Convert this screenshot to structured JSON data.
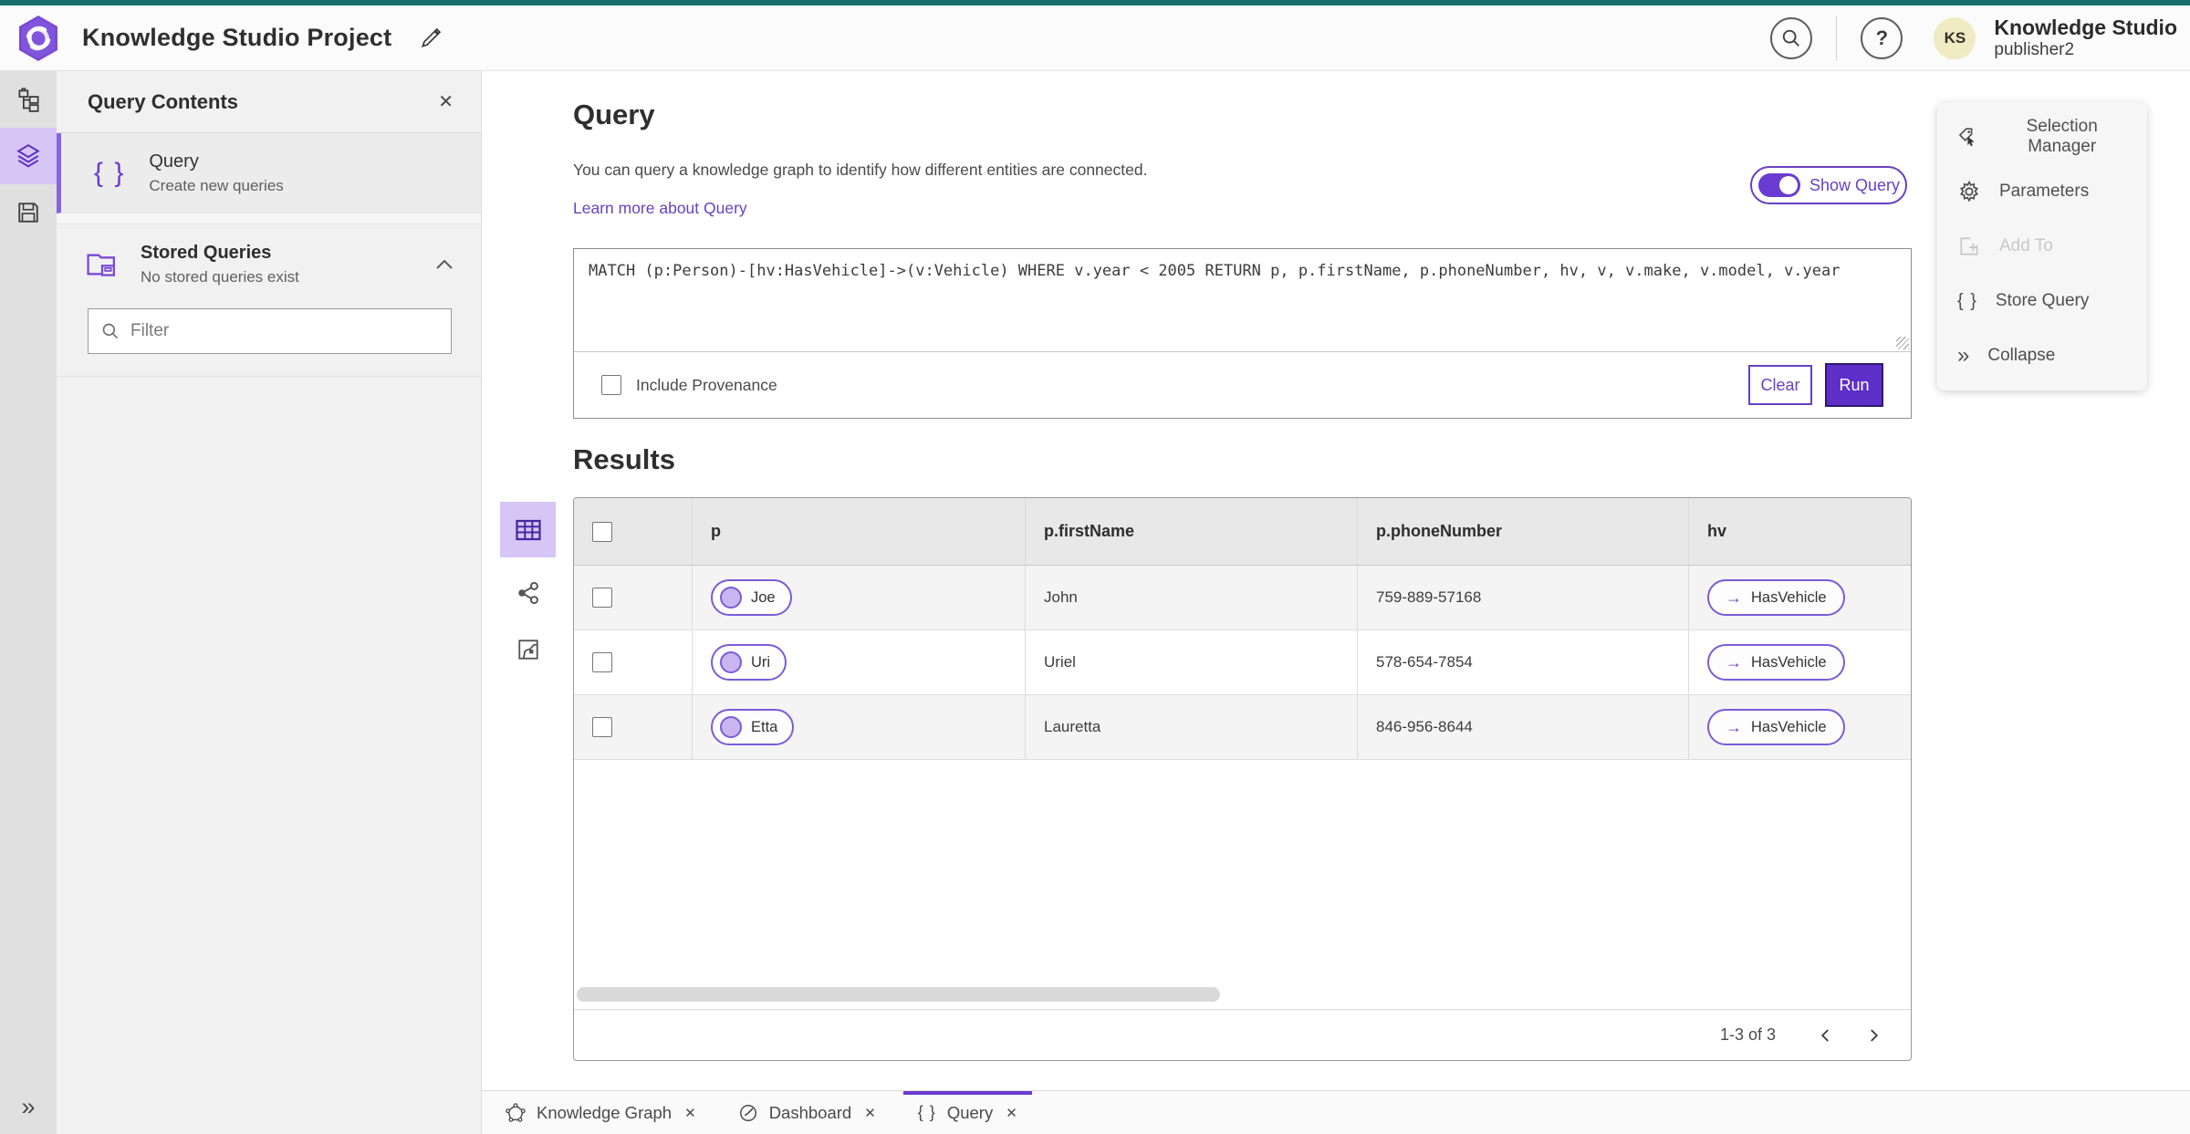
{
  "header": {
    "title": "Knowledge Studio Project",
    "user": {
      "initials": "KS",
      "name": "Knowledge Studio",
      "role": "publisher2"
    }
  },
  "left_panel": {
    "title": "Query Contents",
    "query_item": {
      "title": "Query",
      "subtitle": "Create new queries"
    },
    "stored_queries": {
      "title": "Stored Queries",
      "subtitle": "No stored queries exist"
    },
    "filter_placeholder": "Filter"
  },
  "query_section": {
    "title": "Query",
    "description": "You can query a knowledge graph to identify how different entities are connected.",
    "learn_more": "Learn more about Query",
    "show_query": "Show Query",
    "query_text": "MATCH (p:Person)-[hv:HasVehicle]->(v:Vehicle) WHERE v.year < 2005 RETURN p, p.firstName, p.phoneNumber, hv, v, v.make, v.model, v.year",
    "include_provenance": "Include Provenance",
    "clear": "Clear",
    "run": "Run"
  },
  "results": {
    "title": "Results",
    "columns": [
      "p",
      "p.firstName",
      "p.phoneNumber",
      "hv"
    ],
    "rows": [
      {
        "entity": "Joe",
        "firstName": "John",
        "phone": "759-889-57168",
        "relation": "HasVehicle"
      },
      {
        "entity": "Uri",
        "firstName": "Uriel",
        "phone": "578-654-7854",
        "relation": "HasVehicle"
      },
      {
        "entity": "Etta",
        "firstName": "Lauretta",
        "phone": "846-956-8644",
        "relation": "HasVehicle"
      }
    ],
    "pagination": "1-3 of 3"
  },
  "context_menu": {
    "items": [
      {
        "label": "Selection Manager",
        "disabled": false
      },
      {
        "label": "Parameters",
        "disabled": false
      },
      {
        "label": "Add To",
        "disabled": true
      },
      {
        "label": "Store Query",
        "disabled": false
      },
      {
        "label": "Collapse",
        "disabled": false
      }
    ]
  },
  "tabs": [
    {
      "label": "Knowledge Graph",
      "active": false
    },
    {
      "label": "Dashboard",
      "active": false
    },
    {
      "label": "Query",
      "active": true
    }
  ],
  "icons": {
    "braces": "{ }",
    "close": "✕",
    "collapse": "»",
    "arrow_right": "→",
    "help": "?"
  },
  "colors": {
    "accent_purple": "#6742c1",
    "run_button": "#5e2ec9",
    "teal_top": "#176e6b",
    "active_icon_bg": "#d7c5f6",
    "pill_border": "#7a5cd8"
  }
}
